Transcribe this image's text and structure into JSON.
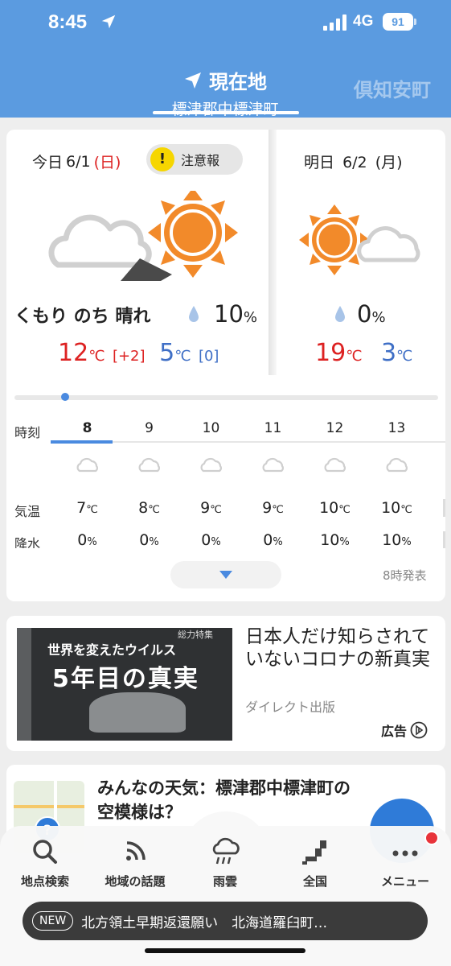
{
  "status_bar": {
    "time": "8:45",
    "network": "4G",
    "battery": "91"
  },
  "header": {
    "current_label": "現在地",
    "current_place": "標津郡中標津町",
    "next_place": "倶知安町"
  },
  "today": {
    "label": "今日",
    "date": "6/1",
    "weekday": "(日)",
    "alert": "注意報",
    "weather": "くもり のち 晴れ",
    "rain_pct": "10",
    "pct_unit": "%",
    "high": "12",
    "high_diff": "[+2]",
    "low": "5",
    "low_diff": "[0]",
    "temp_unit": "℃"
  },
  "tomorrow": {
    "label": "明日",
    "date": "6/2",
    "weekday": "(月)",
    "rain_pct": "0",
    "pct_unit": "%",
    "high": "19",
    "low": "3",
    "temp_unit": "℃"
  },
  "hourly": {
    "labels": {
      "time": "時刻",
      "temp": "気温",
      "rain": "降水"
    },
    "hours": [
      {
        "hour": "8",
        "temp": "7",
        "rain": "0"
      },
      {
        "hour": "9",
        "temp": "8",
        "rain": "0"
      },
      {
        "hour": "10",
        "temp": "9",
        "rain": "0"
      },
      {
        "hour": "11",
        "temp": "9",
        "rain": "0"
      },
      {
        "hour": "12",
        "temp": "10",
        "rain": "10"
      },
      {
        "hour": "13",
        "temp": "10",
        "rain": "10"
      }
    ],
    "temp_unit": "℃",
    "rain_unit": "%",
    "issued": "8時発表"
  },
  "ad": {
    "image_text_1": "世界を変えたウイルス",
    "image_text_2": "5年目の真実",
    "image_tag": "総力特集",
    "title": "日本人だけ知らされていないコロナの新真実",
    "source": "ダイレクト出版",
    "label": "広告"
  },
  "community": {
    "title": "みんなの天気：標津郡中標津町の空模様は？",
    "map_badge": "?"
  },
  "nav": {
    "items": [
      "地点検索",
      "地域の話題",
      "雨雲",
      "全国",
      "メニュー"
    ]
  },
  "ticker": {
    "badge": "NEW",
    "text": "北方領土早期返還願い　北海道羅臼町…"
  },
  "colors": {
    "header_blue": "#5b9be0",
    "accent_blue": "#4a8ae0",
    "high_red": "#dd2222",
    "low_blue": "#3f6fc6",
    "sun_orange": "#f28a2a",
    "alert_yellow": "#f6d600"
  }
}
